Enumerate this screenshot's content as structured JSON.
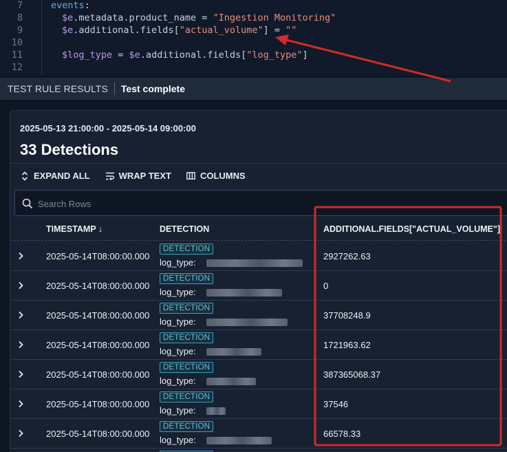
{
  "editor": {
    "lines": [
      {
        "num": "7",
        "tokens": [
          {
            "t": "events",
            "c": "kw"
          },
          {
            "t": ":",
            "c": "pun"
          }
        ],
        "indent": 0
      },
      {
        "num": "8",
        "tokens": [
          {
            "t": "$e",
            "c": "var"
          },
          {
            "t": ".metadata.product_name = ",
            "c": "prop"
          },
          {
            "t": "\"Ingestion Monitoring\"",
            "c": "str"
          }
        ],
        "indent": 1
      },
      {
        "num": "9",
        "tokens": [
          {
            "t": "$e",
            "c": "var"
          },
          {
            "t": ".additional.fields[",
            "c": "prop"
          },
          {
            "t": "\"actual_volume\"",
            "c": "str"
          },
          {
            "t": "] = ",
            "c": "prop"
          },
          {
            "t": "\"\"",
            "c": "str"
          }
        ],
        "indent": 1
      },
      {
        "num": "10",
        "tokens": [],
        "indent": 1
      },
      {
        "num": "11",
        "tokens": [
          {
            "t": "$log_type",
            "c": "var"
          },
          {
            "t": " = ",
            "c": "prop"
          },
          {
            "t": "$e",
            "c": "var"
          },
          {
            "t": ".additional.fields[",
            "c": "prop"
          },
          {
            "t": "\"log_type\"",
            "c": "str"
          },
          {
            "t": "]",
            "c": "prop"
          }
        ],
        "indent": 1
      },
      {
        "num": "12",
        "tokens": [],
        "indent": 1
      }
    ]
  },
  "results_bar": {
    "title": "TEST RULE RESULTS",
    "status": "Test complete"
  },
  "panel": {
    "time_range": "2025-05-13 21:00:00 - 2025-05-14 09:00:00",
    "detections_title": "33 Detections",
    "toolbar": {
      "expand_all": "EXPAND ALL",
      "wrap_text": "WRAP TEXT",
      "columns": "COLUMNS"
    },
    "search_placeholder": "Search Rows"
  },
  "table": {
    "headers": {
      "timestamp": "TIMESTAMP ↓",
      "detection": "DETECTION",
      "actual_volume": "ADDITIONAL.FIELDS[\"ACTUAL_VOLUME\"]"
    },
    "rows": [
      {
        "timestamp": "2025-05-14T08:00:00.000",
        "badge": "DETECTION",
        "log_type_prefix": "log_type:",
        "actual_volume": "2927262.63"
      },
      {
        "timestamp": "2025-05-14T08:00:00.000",
        "badge": "DETECTION",
        "log_type_prefix": "log_type:",
        "actual_volume": "0"
      },
      {
        "timestamp": "2025-05-14T08:00:00.000",
        "badge": "DETECTION",
        "log_type_prefix": "log_type:",
        "actual_volume": "37708248.9"
      },
      {
        "timestamp": "2025-05-14T08:00:00.000",
        "badge": "DETECTION",
        "log_type_prefix": "log_type:",
        "actual_volume": "1721963.62"
      },
      {
        "timestamp": "2025-05-14T08:00:00.000",
        "badge": "DETECTION",
        "log_type_prefix": "log_type:",
        "actual_volume": "387365068.37"
      },
      {
        "timestamp": "2025-05-14T08:00:00.000",
        "badge": "DETECTION",
        "log_type_prefix": "log_type:",
        "actual_volume": "37546"
      },
      {
        "timestamp": "2025-05-14T08:00:00.000",
        "badge": "DETECTION",
        "log_type_prefix": "log_type:",
        "actual_volume": "66578.33"
      }
    ],
    "partial_row_badge": "DETECTION"
  },
  "colors": {
    "annotation_red": "#d42a2a",
    "badge_teal": "#5fc3d8"
  },
  "icons": [
    "chevron-right-icon",
    "expand-icon",
    "wrap-text-icon",
    "columns-icon",
    "search-icon"
  ]
}
